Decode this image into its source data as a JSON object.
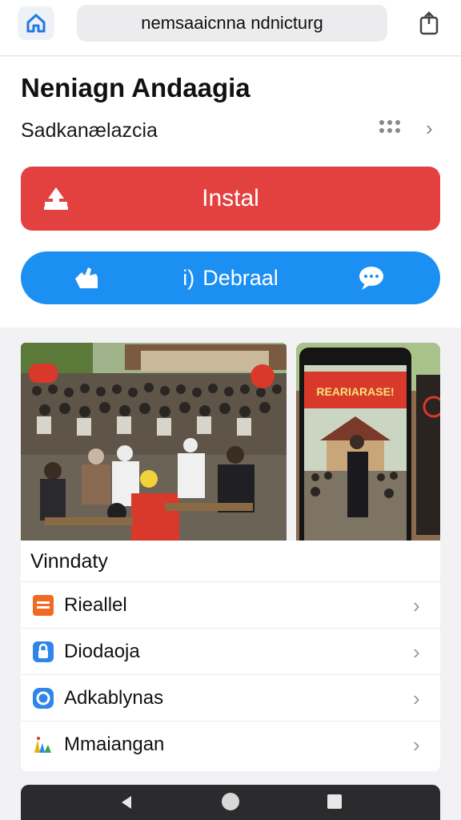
{
  "browser": {
    "url": "nemsaaicnna ndnicturg",
    "home_icon": "home-icon",
    "share_icon": "share-icon"
  },
  "app": {
    "title": "Neniagn Andaagia",
    "subtitle": "Sadkanælazcia",
    "install_label": "Instal",
    "debit_label": "Debraal",
    "debit_prefix": "i)"
  },
  "screenshots": {
    "banner_text": "REARIARASE!"
  },
  "list": {
    "heading": "Vinndaty",
    "items": [
      {
        "label": "Rieallel",
        "icon": "orange-card-icon",
        "color": "#f06a23"
      },
      {
        "label": "Diodaoja",
        "icon": "blue-lock-icon",
        "color": "#2f86e8"
      },
      {
        "label": "Adkablynas",
        "icon": "blue-circle-icon",
        "color": "#2f86e8"
      },
      {
        "label": "Mmaiangan",
        "icon": "palette-icon",
        "color": "#e6b400"
      }
    ]
  },
  "colors": {
    "install": "#e34040",
    "debit": "#1c8ff2",
    "accent_blue": "#1f7ae0"
  }
}
